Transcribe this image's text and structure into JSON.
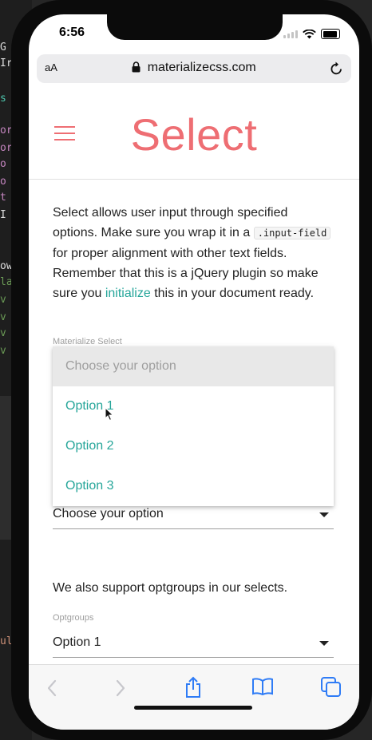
{
  "status": {
    "time": "6:56"
  },
  "browser": {
    "aa": "aA",
    "url": "materializecss.com"
  },
  "page": {
    "title": "Select",
    "description": {
      "part1": "Select allows user input through specified options. Make sure you wrap it in a",
      "code": ".input-field",
      "part2": "for proper alignment with other text fields. Remember that this is a jQuery plugin so make sure you",
      "link": "initialize",
      "part3": "this in your document ready."
    },
    "select1": {
      "label": "Materialize Select",
      "value": "Choose your option",
      "dropdown": [
        "Choose your option",
        "Option 1",
        "Option 2",
        "Option 3"
      ]
    },
    "optgroups_text": "We also support optgroups in our selects.",
    "select2": {
      "label": "Optgroups",
      "value": "Option 1"
    }
  },
  "colors": {
    "accent": "#ee6e73",
    "teal": "#26a69a",
    "ios_blue": "#2f7cf6"
  },
  "icons": [
    "menu-icon",
    "lock-icon",
    "reload-icon",
    "back-icon",
    "forward-icon",
    "share-icon",
    "bookmarks-icon",
    "tabs-icon",
    "caret-down-icon"
  ]
}
